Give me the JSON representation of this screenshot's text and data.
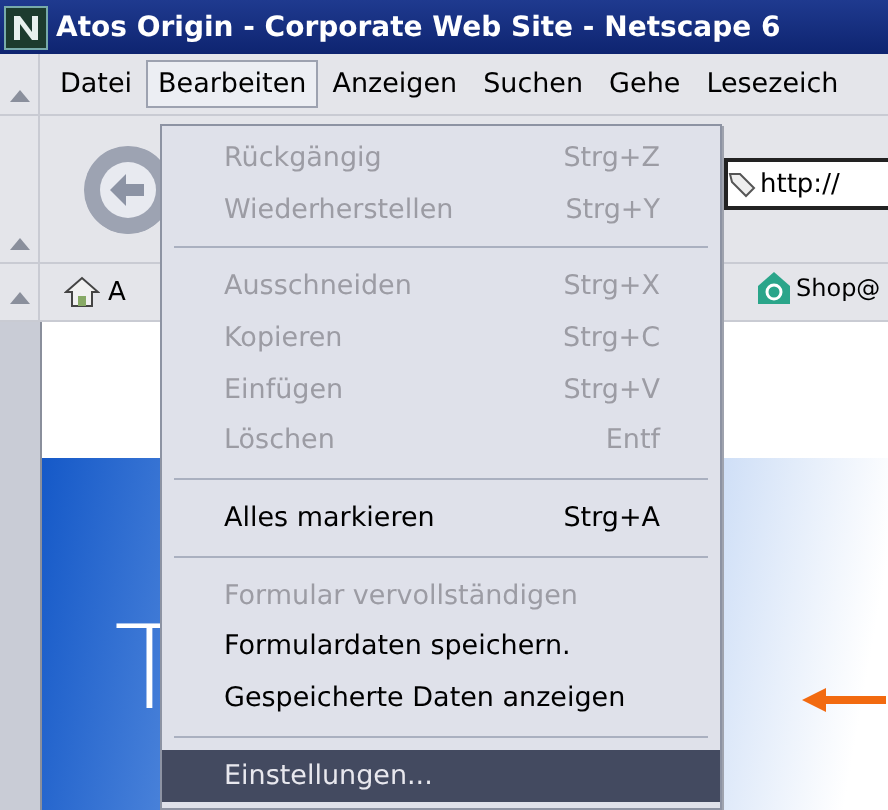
{
  "window": {
    "title": "Atos Origin - Corporate Web Site - Netscape 6"
  },
  "menu_bar": [
    {
      "label": "Datei",
      "selected": false
    },
    {
      "label": "Bearbeiten",
      "selected": true
    },
    {
      "label": "Anzeigen",
      "selected": false
    },
    {
      "label": "Suchen",
      "selected": false
    },
    {
      "label": "Gehe",
      "selected": false
    },
    {
      "label": "Lesezeich",
      "selected": false
    }
  ],
  "address_field": {
    "value": "http://"
  },
  "personal_toolbar": [
    {
      "label": "A"
    },
    {
      "label": "Shop@"
    }
  ],
  "page": {
    "heading_lines": [
      "T"
    ]
  },
  "edit_menu": [
    {
      "kind": "item",
      "label": "Rückgängig",
      "shortcut": "Strg+Z",
      "disabled": true,
      "selected": false
    },
    {
      "kind": "item",
      "label": "Wiederherstellen",
      "shortcut": "Strg+Y",
      "disabled": true,
      "selected": false
    },
    {
      "kind": "separator"
    },
    {
      "kind": "item",
      "label": "Ausschneiden",
      "shortcut": "Strg+X",
      "disabled": true,
      "selected": false
    },
    {
      "kind": "item",
      "label": "Kopieren",
      "shortcut": "Strg+C",
      "disabled": true,
      "selected": false
    },
    {
      "kind": "item",
      "label": "Einfügen",
      "shortcut": "Strg+V",
      "disabled": true,
      "selected": false
    },
    {
      "kind": "item",
      "label": "Löschen",
      "shortcut": "Entf",
      "disabled": true,
      "selected": false
    },
    {
      "kind": "separator"
    },
    {
      "kind": "item",
      "label": "Alles markieren",
      "shortcut": "Strg+A",
      "disabled": false,
      "selected": false
    },
    {
      "kind": "separator"
    },
    {
      "kind": "item",
      "label": "Formular vervollständigen",
      "disabled": true,
      "selected": false
    },
    {
      "kind": "item",
      "label": "Formulardaten speichern.",
      "disabled": false,
      "selected": false
    },
    {
      "kind": "item",
      "label": "Gespeicherte Daten anzeigen",
      "disabled": false,
      "selected": false
    },
    {
      "kind": "separator"
    },
    {
      "kind": "item",
      "label": "Einstellungen...",
      "disabled": false,
      "selected": true
    }
  ]
}
